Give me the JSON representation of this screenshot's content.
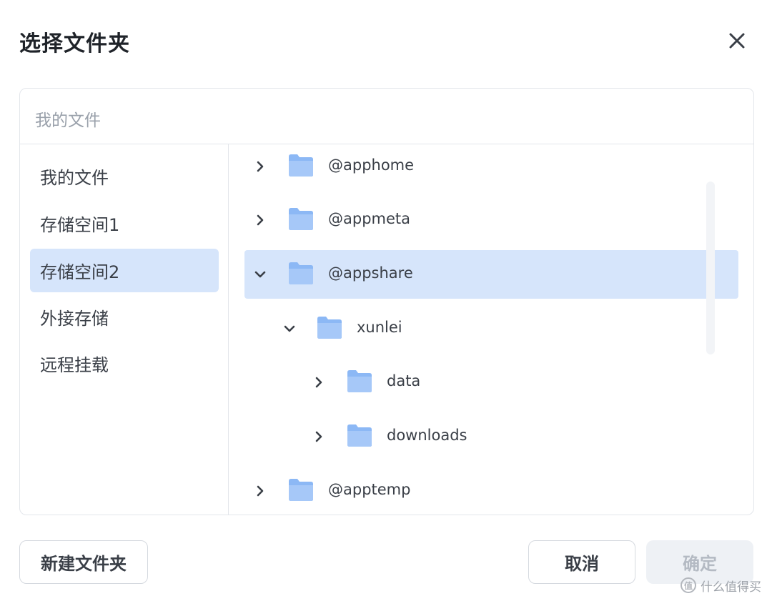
{
  "dialog": {
    "title": "选择文件夹",
    "close_icon": "close-icon"
  },
  "path_bar": {
    "text": "我的文件"
  },
  "sidebar": {
    "items": [
      {
        "label": "我的文件",
        "active": false
      },
      {
        "label": "存储空间1",
        "active": false
      },
      {
        "label": "存储空间2",
        "active": true
      },
      {
        "label": "外接存储",
        "active": false
      },
      {
        "label": "远程挂载",
        "active": false
      }
    ]
  },
  "tree": {
    "rows": [
      {
        "label": "@apphome",
        "level": 0,
        "expanded": false,
        "selected": false,
        "icon": "folder-icon"
      },
      {
        "label": "@appmeta",
        "level": 0,
        "expanded": false,
        "selected": false,
        "icon": "folder-icon"
      },
      {
        "label": "@appshare",
        "level": 0,
        "expanded": true,
        "selected": true,
        "icon": "folder-icon"
      },
      {
        "label": "xunlei",
        "level": 1,
        "expanded": true,
        "selected": false,
        "icon": "folder-icon"
      },
      {
        "label": "data",
        "level": 2,
        "expanded": false,
        "selected": false,
        "icon": "folder-icon"
      },
      {
        "label": "downloads",
        "level": 2,
        "expanded": false,
        "selected": false,
        "icon": "folder-icon"
      },
      {
        "label": "@apptemp",
        "level": 0,
        "expanded": false,
        "selected": false,
        "icon": "folder-icon"
      }
    ]
  },
  "buttons": {
    "new_folder": "新建文件夹",
    "cancel": "取消",
    "confirm": "确定"
  },
  "watermark": {
    "badge": "值",
    "text": "什么值得买"
  },
  "colors": {
    "accent_selected": "#d6e5fb",
    "folder_blue": "#8cb8f5",
    "disabled_button_bg": "#eef1f5",
    "disabled_button_text": "#b4bac3"
  }
}
